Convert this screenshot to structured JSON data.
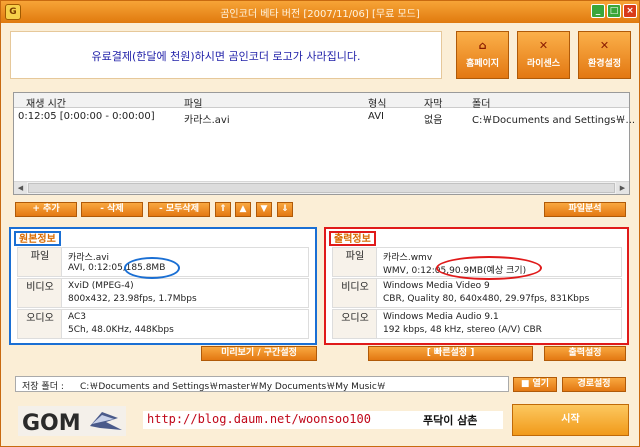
{
  "window": {
    "title": "곰인코더 베타 버전 [2007/11/06] [무료 모드]",
    "app_icon_letter": "G"
  },
  "banner": {
    "text": "유료결제(한달에 천원)하시면 곰인코더 로고가 사라집니다."
  },
  "top_buttons": [
    {
      "label": "홈페이지",
      "icon": "home-icon"
    },
    {
      "label": "라이센스",
      "icon": "license-icon"
    },
    {
      "label": "환경설정",
      "icon": "settings-icon"
    }
  ],
  "file_list": {
    "columns": [
      "재생 시간",
      "파일",
      "형식",
      "자막",
      "폴더"
    ],
    "rows": [
      [
        "0:12:05 [0:00:00 - 0:00:00]",
        "카라스.avi",
        "AVI",
        "없음",
        "C:￦Documents and Settings￦..."
      ]
    ]
  },
  "list_buttons": {
    "add": "+ 추가",
    "delete": "- 삭제",
    "delete_all": "- 모두삭제",
    "analyze": "파일분석"
  },
  "source_info": {
    "title": "원본정보",
    "rows": [
      {
        "label": "파일",
        "line1": "카라스.avi",
        "line2_prefix": "AVI, 0:12:05,",
        "line2_highlight": "185.8MB"
      },
      {
        "label": "비디오",
        "line1": "XviD (MPEG-4)",
        "line2": "800x432, 23.98fps, 1.7Mbps"
      },
      {
        "label": "오디오",
        "line1": "AC3",
        "line2": "5Ch, 48.0KHz, 448Kbps"
      }
    ],
    "preview_button": "미리보기 / 구간설정"
  },
  "output_info": {
    "title": "출력정보",
    "rows": [
      {
        "label": "파일",
        "line1": "카라스.wmv",
        "line2_prefix": "WMV, 0:12:05,",
        "line2_highlight": "90.9MB(예상 크기)"
      },
      {
        "label": "비디오",
        "line1": "Windows Media Video 9",
        "line2": "CBR, Quality 80, 640x480, 29.97fps, 831Kbps"
      },
      {
        "label": "오디오",
        "line1": "Windows Media Audio 9.1",
        "line2": "192 kbps, 48 kHz, stereo (A/V) CBR"
      }
    ],
    "quick_button": "[ 빠른설정 ]",
    "output_button": "출력설정"
  },
  "save_folder": {
    "label": "저장 폴더 :",
    "path": "C:￦Documents and Settings￦master￦My Documents￦My Music￦",
    "open_button": "열기",
    "path_button": "경로설정"
  },
  "footer": {
    "logo_text": "GOM",
    "url": "http://blog.daum.net/woonsoo100",
    "signature": "푸닥이 삼촌",
    "start_button": "시작"
  },
  "colors": {
    "accent": "#f08a1c",
    "source_border": "#1a6fd4",
    "output_border": "#e01a1a",
    "banner_text": "#1f1fa8",
    "url_text": "#c0081a"
  }
}
